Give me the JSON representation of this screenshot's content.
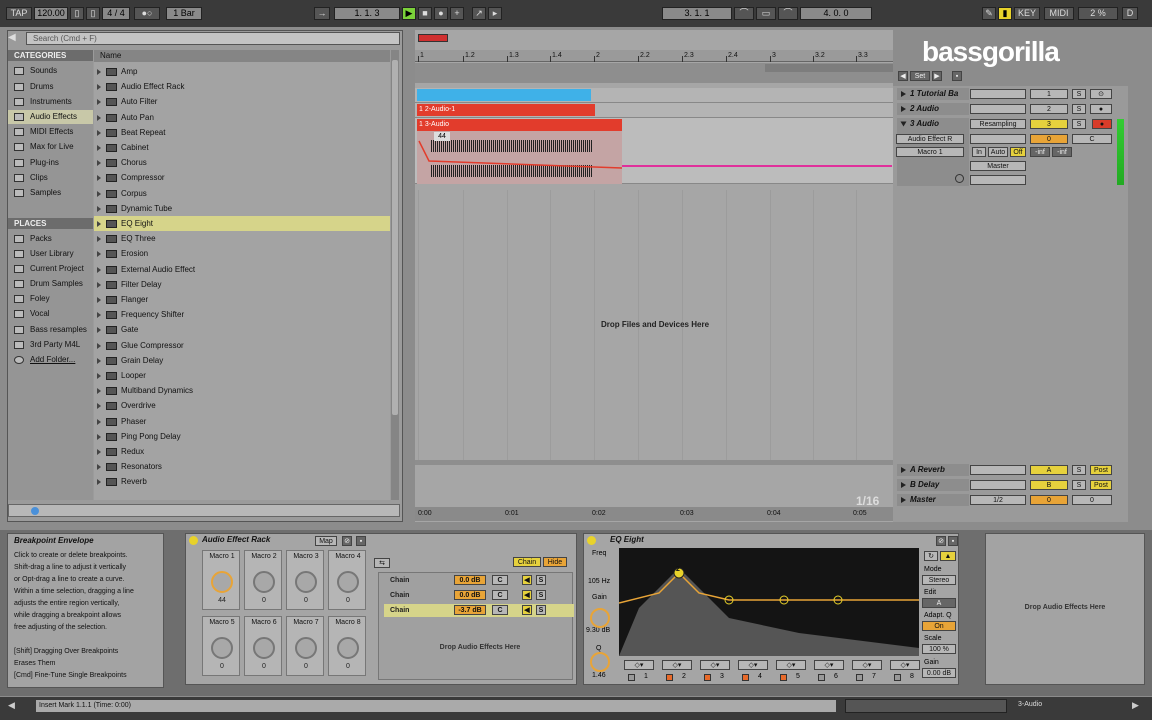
{
  "transport": {
    "tap": "TAP",
    "tempo": "120.00",
    "signature": "4 / 4",
    "quant": "1 Bar",
    "position": "1.  1.  3",
    "loop_start": "3.  1.  1",
    "loop_length": "4.  0.  0",
    "key": "KEY",
    "midi": "MIDI",
    "cpu": "2 %",
    "d": "D"
  },
  "browser": {
    "search_placeholder": "Search (Cmd + F)",
    "categories_header": "CATEGORIES",
    "categories": [
      "Sounds",
      "Drums",
      "Instruments",
      "Audio Effects",
      "MIDI Effects",
      "Max for Live",
      "Plug-ins",
      "Clips",
      "Samples"
    ],
    "places_header": "PLACES",
    "places": [
      "Packs",
      "User Library",
      "Current Project",
      "Drum Samples",
      "Foley",
      "Vocal",
      "Bass resamples",
      "3rd Party M4L",
      "Add Folder..."
    ],
    "name_header": "Name",
    "items": [
      "Amp",
      "Audio Effect Rack",
      "Auto Filter",
      "Auto Pan",
      "Beat Repeat",
      "Cabinet",
      "Chorus",
      "Compressor",
      "Corpus",
      "Dynamic Tube",
      "EQ Eight",
      "EQ Three",
      "Erosion",
      "External Audio Effect",
      "Filter Delay",
      "Flanger",
      "Frequency Shifter",
      "Gate",
      "Glue Compressor",
      "Grain Delay",
      "Looper",
      "Multiband Dynamics",
      "Overdrive",
      "Phaser",
      "Ping Pong Delay",
      "Redux",
      "Resonators",
      "Reverb"
    ]
  },
  "arrangement": {
    "ruler": [
      "1",
      "1.2",
      "1.3",
      "1.4",
      "2",
      "2.2",
      "2.3",
      "2.4",
      "3",
      "3.2",
      "3.3"
    ],
    "clips": [
      "1 2-Audio-1",
      "1 3-Audio"
    ],
    "clip_marker": "44",
    "drop_text": "Drop Files and Devices Here",
    "quantization": "1/16",
    "timeline": [
      "0:00",
      "0:01",
      "0:02",
      "0:03",
      "0:04",
      "0:05"
    ]
  },
  "mixer": {
    "set_label": "Set",
    "tracks": [
      {
        "name": "1 Tutorial Ba",
        "num": "1"
      },
      {
        "name": "2 Audio",
        "num": "2"
      },
      {
        "name": "3 Audio",
        "num": "3"
      }
    ],
    "input": "Resampling",
    "device_chooser": "Audio Effect R",
    "macro_chooser": "Macro 1",
    "monitor": [
      "In",
      "Auto",
      "Off"
    ],
    "inf1": "-inf",
    "inf2": "-inf",
    "output": "Master",
    "solo": "S",
    "zero": "0",
    "c": "C",
    "returns": [
      {
        "name": "A Reverb",
        "letter": "A"
      },
      {
        "name": "B Delay",
        "letter": "B"
      },
      {
        "name": "Master",
        "letter": "1/2"
      }
    ],
    "post": "Post"
  },
  "logo": "bassgorilla",
  "info": {
    "title": "Breakpoint Envelope",
    "lines": [
      "Click to create or delete breakpoints.",
      "Shift-drag a line to adjust it vertically",
      "or Opt-drag a line to create a curve.",
      "Within a time selection, dragging a line",
      "adjusts the entire region vertically,",
      "while dragging a breakpoint allows",
      "free adjusting of the selection.",
      "",
      "[Shift] Dragging Over Breakpoints",
      "Erases Them",
      "[Cmd] Fine-Tune Single Breakpoints"
    ]
  },
  "rack": {
    "title": "Audio Effect Rack",
    "map": "Map",
    "macros": [
      {
        "label": "Macro 1",
        "value": "44"
      },
      {
        "label": "Macro 2",
        "value": "0"
      },
      {
        "label": "Macro 3",
        "value": "0"
      },
      {
        "label": "Macro 4",
        "value": "0"
      },
      {
        "label": "Macro 5",
        "value": "0"
      },
      {
        "label": "Macro 6",
        "value": "0"
      },
      {
        "label": "Macro 7",
        "value": "0"
      },
      {
        "label": "Macro 8",
        "value": "0"
      }
    ],
    "chain_btn": "Chain",
    "hide_btn": "Hide",
    "chains": [
      {
        "name": "Chain",
        "vol": "0.0 dB",
        "pan": "C"
      },
      {
        "name": "Chain",
        "vol": "0.0 dB",
        "pan": "C"
      },
      {
        "name": "Chain",
        "vol": "-3.7 dB",
        "pan": "C"
      }
    ],
    "drop_text": "Drop Audio Effects Here"
  },
  "eq": {
    "title": "EQ Eight",
    "freq_label": "Freq",
    "freq_value": "105 Hz",
    "gain_label": "Gain",
    "gain_value": "9.30 dB",
    "q_label": "Q",
    "q_value": "1.46",
    "mode_label": "Mode",
    "mode_value": "Stereo",
    "edit_label": "Edit",
    "edit_value": "A",
    "adapt_label": "Adapt. Q",
    "adapt_value": "On",
    "scale_label": "Scale",
    "scale_value": "100 %",
    "out_gain_label": "Gain",
    "out_gain_value": "0.00 dB",
    "bands": [
      "1",
      "2",
      "3",
      "4",
      "5",
      "6",
      "7",
      "8"
    ],
    "band_marker": "2"
  },
  "dropfx": "Drop Audio Effects Here",
  "status": {
    "text": "Insert Mark 1.1.1 (Time: 0:00)",
    "track": "3-Audio"
  }
}
